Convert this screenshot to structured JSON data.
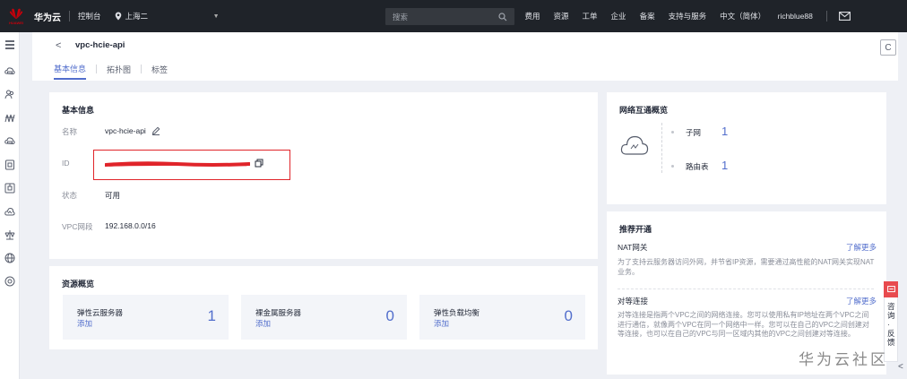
{
  "topbar": {
    "logo_text": "HUAWEI",
    "brand": "华为云",
    "console": "控制台",
    "region": "上海二",
    "search_placeholder": "搜索",
    "nav": [
      "费用",
      "资源",
      "工单",
      "企业",
      "备案",
      "支持与服务",
      "中文（简体）"
    ],
    "username": "richblue88"
  },
  "sidebar": {
    "icons": [
      "menu-icon",
      "cloud-host-icon",
      "users-icon",
      "network-icon",
      "cloud-host-icon",
      "gateway-icon",
      "security-icon",
      "cloud-icon",
      "balance-icon",
      "globe-icon",
      "settings-icon"
    ]
  },
  "header": {
    "title": "vpc-hcie-api",
    "tabs": [
      {
        "label": "基本信息",
        "active": true
      },
      {
        "label": "拓扑图",
        "active": false
      },
      {
        "label": "标签",
        "active": false
      }
    ]
  },
  "basic_info": {
    "title": "基本信息",
    "name_label": "名称",
    "name_value": "vpc-hcie-api",
    "id_label": "ID",
    "status_label": "状态",
    "status_value": "可用",
    "cidr_label": "VPC网段",
    "cidr_value": "192.168.0.0/16"
  },
  "resources": {
    "title": "资源概览",
    "items": [
      {
        "name": "弹性云服务器",
        "add": "添加",
        "count": "1"
      },
      {
        "name": "裸金属服务器",
        "add": "添加",
        "count": "0"
      },
      {
        "name": "弹性负载均衡",
        "add": "添加",
        "count": "0"
      }
    ]
  },
  "interconnect": {
    "title": "网络互通概览",
    "subnet_label": "子网",
    "subnet_count": "1",
    "route_label": "路由表",
    "route_count": "1"
  },
  "recommend": {
    "title": "推荐开通",
    "more": "了解更多",
    "items": [
      {
        "name": "NAT网关",
        "desc": "为了支持云服务器访问外网，并节省IP资源，需要通过高性能的NAT网关实现NAT业务。"
      },
      {
        "name": "对等连接",
        "desc": "对等连接是指两个VPC之间的网络连接。您可以使用私有IP地址在两个VPC之间进行通信，就像两个VPC在同一个网络中一样。您可以在自己的VPC之间创建对等连接，也可以在自己的VPC与同一区域内其他的VPC之间创建对等连接。"
      }
    ]
  },
  "feedback": {
    "label": "咨询·反馈"
  },
  "watermark": "华为云社区",
  "colors": {
    "accent": "#526ecc",
    "topbar": "#1f2329",
    "highlight": "#e0242a"
  }
}
